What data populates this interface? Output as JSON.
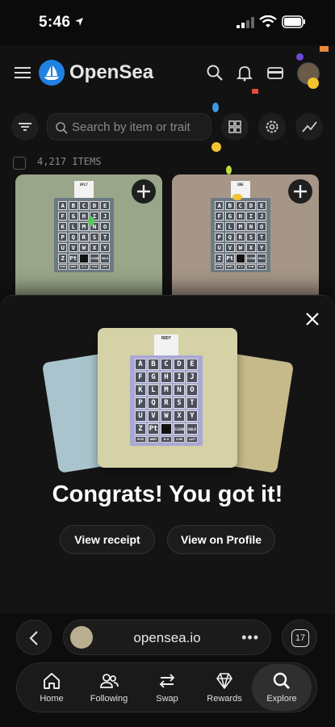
{
  "status": {
    "time": "5:46"
  },
  "header": {
    "brand": "OpenSea"
  },
  "search": {
    "placeholder": "Search by item or trait"
  },
  "items": {
    "count": "4,217 ITEMS"
  },
  "modal": {
    "title": "Congrats! You got it!",
    "view_receipt": "View receipt",
    "view_profile": "View on Profile"
  },
  "browser": {
    "url": "opensea.io",
    "tab_count": "17"
  },
  "nav": [
    {
      "label": "Home",
      "icon": "home-icon"
    },
    {
      "label": "Following",
      "icon": "following-icon"
    },
    {
      "label": "Swap",
      "icon": "swap-icon"
    },
    {
      "label": "Rewards",
      "icon": "diamond-icon"
    },
    {
      "label": "Explore",
      "icon": "search-icon",
      "active": true
    }
  ],
  "nft_keys": {
    "rows": [
      [
        "A",
        "B",
        "C",
        "D",
        "E"
      ],
      [
        "F",
        "G",
        "H",
        "I",
        "J"
      ],
      [
        "K",
        "L",
        "M",
        "N",
        "O"
      ],
      [
        "P",
        "Q",
        "R",
        "S",
        "T"
      ],
      [
        "U",
        "V",
        "W",
        "X",
        "Y"
      ]
    ],
    "last_row": [
      "Z",
      "Pt",
      "",
      "CLEAR",
      "HOLD"
    ],
    "func_row": [
      "RYSE",
      "WREX",
      "B-6",
      "ICHR",
      "LAST"
    ],
    "card_left_label": "OPLT",
    "card_right_label": "UNE",
    "featured_label": "RDDT"
  },
  "colors": {
    "accent_blue": "#2081e2",
    "card_green": "#9aa68a",
    "card_pink": "#a69688",
    "featured_bg": "#d4d2a6",
    "machine_purple": "#a9a8d4"
  }
}
